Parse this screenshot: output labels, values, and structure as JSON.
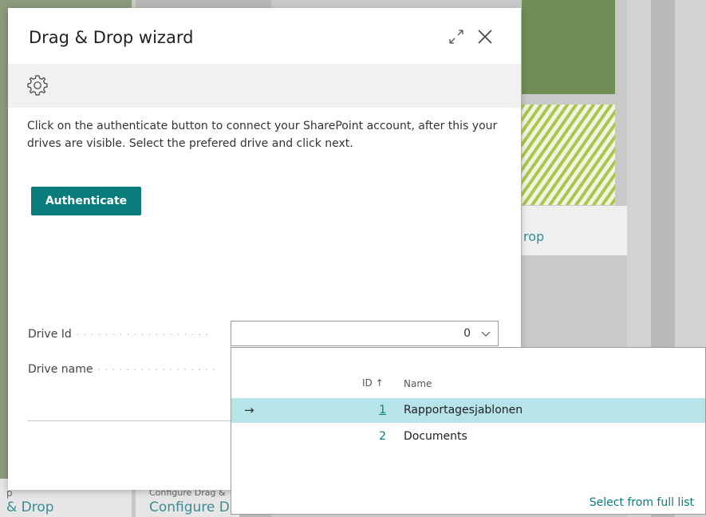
{
  "background": {
    "card_text": "rop",
    "bottom_left_small": "p",
    "bottom_left_big": "& Drop",
    "bottom_mid_small": "Configure Drag &",
    "bottom_mid_big": "Configure Dr"
  },
  "dialog": {
    "title": "Drag & Drop wizard",
    "instruction": "Click on the authenticate button to connect your SharePoint account, after this your drives are visible. Select the prefered drive and click next.",
    "authenticate_label": "Authenticate",
    "fields": {
      "drive_id_label": "Drive Id",
      "drive_id_value": "0",
      "drive_name_label": "Drive name"
    }
  },
  "dropdown": {
    "columns": {
      "id": "ID ↑",
      "name": "Name"
    },
    "rows": [
      {
        "id": "1",
        "name": "Rapportagesjablonen",
        "selected": true
      },
      {
        "id": "2",
        "name": "Documents",
        "selected": false
      }
    ],
    "full_list_link": "Select from full list"
  },
  "colors": {
    "accent": "#0b7c7c",
    "selected_row": "#b6e4e9"
  },
  "icons": [
    "expand-icon",
    "close-icon",
    "gear-icon",
    "chevron-down-icon",
    "row-arrow-icon"
  ]
}
